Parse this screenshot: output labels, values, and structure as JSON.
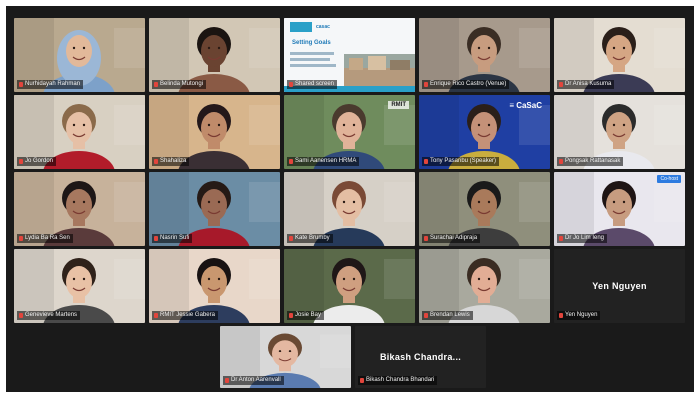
{
  "participants": [
    {
      "id": "p1",
      "name": "Nurhidayah Rahman",
      "bg": "#b9a98f",
      "skin": "#e2b99a",
      "top": "#7da1c9",
      "hair": "#9bb7d6",
      "hijab": true
    },
    {
      "id": "p2",
      "name": "Belinda Mutongi",
      "bg": "#d2c7b5",
      "skin": "#6a4331",
      "top": "#8a5a45",
      "hair": "#1b1411"
    },
    {
      "id": "p3",
      "name": "Shared screen",
      "slide": true
    },
    {
      "id": "p4",
      "name": "Enrique Rico Castro (Venue)",
      "bg": "#a79a8c",
      "skin": "#c79c7f",
      "top": "#2b3544",
      "hair": "#3a2d24"
    },
    {
      "id": "p5",
      "name": "Dr Anisa Kusuma",
      "bg": "#e4ddd2",
      "skin": "#d5a684",
      "top": "#3b3b55",
      "hair": "#2a1f1a"
    },
    {
      "id": "p6",
      "name": "Jo Gordon",
      "bg": "#d8d0c2",
      "skin": "#e6c0a6",
      "top": "#b21c2a",
      "hair": "#8a6a4a",
      "active": true
    },
    {
      "id": "p7",
      "name": "Shahaliza",
      "bg": "#d7b58c",
      "skin": "#c08b6a",
      "top": "#3a2f34",
      "hair": "#24181a"
    },
    {
      "id": "p8",
      "name": "Sami Aanensen HRMA",
      "bg": "#6f8c5d",
      "skin": "#e0b399",
      "top": "#304a7a",
      "hair": "#4a3a2e",
      "logo": "RMIT"
    },
    {
      "id": "p9",
      "name": "Tony Pasaribu (Speaker)",
      "bg": "#1f3fa3",
      "skin": "#c49178",
      "top": "#c9ad3e",
      "hair": "#2a1f1a",
      "banner": "≡ CaSaC"
    },
    {
      "id": "p10",
      "name": "Pongsak Rattanasak",
      "bg": "#e5e1dc",
      "skin": "#cfa384",
      "top": "#e9e9ee",
      "hair": "#2b2b2b"
    },
    {
      "id": "p11",
      "name": "Lydia Ba Ra Sen",
      "bg": "#c7b29b",
      "skin": "#a7785f",
      "top": "#5a3b3b",
      "hair": "#1d1616"
    },
    {
      "id": "p12",
      "name": "Nasrin Sufi",
      "bg": "#6b8da5",
      "skin": "#9a6a54",
      "top": "#a7192a",
      "hair": "#251a16"
    },
    {
      "id": "p13",
      "name": "Kate Brumby",
      "bg": "#d6d0c7",
      "skin": "#e4bea3",
      "top": "#263a5a",
      "hair": "#7a4a36"
    },
    {
      "id": "p14",
      "name": "Surachai Adipraja",
      "bg": "#8f8f7c",
      "skin": "#a97a5b",
      "top": "#3d3d3d",
      "hair": "#1a1a1a"
    },
    {
      "id": "p15",
      "name": "Dr Jo Lim Ieng",
      "bg": "#e9e7ee",
      "skin": "#c79c80",
      "top": "#5b4a6a",
      "hair": "#1f1515",
      "badge": "Co-host"
    },
    {
      "id": "p16",
      "name": "Genevieve Martens",
      "bg": "#ddd6cc",
      "skin": "#e8c1a5",
      "top": "#4a4a4a",
      "hair": "#2f221a"
    },
    {
      "id": "p17",
      "name": "RMIT Jessie Gabera",
      "bg": "#e8d7c9",
      "skin": "#c9976f",
      "top": "#2d3d5e",
      "hair": "#181212"
    },
    {
      "id": "p18",
      "name": "Josie Bay",
      "bg": "#5b6a4a",
      "skin": "#cf9f80",
      "top": "#ececec",
      "hair": "#1f1717"
    },
    {
      "id": "p19",
      "name": "Brendan Lewis",
      "bg": "#a9a99e",
      "skin": "#e2ad95",
      "top": "#d7d7d7",
      "hair": "#3a2c22"
    },
    {
      "id": "p20",
      "name": "Yen Nguyen",
      "noVideo": true
    },
    {
      "id": "p21",
      "name": "Dr Anton Aarenvall",
      "bg": "#d8d8d8",
      "skin": "#e4b8a1",
      "top": "#5a7bb0",
      "hair": "#6a4a34"
    },
    {
      "id": "p22",
      "name": "Bikash Chandra...",
      "noVideo": true,
      "plateName": "Bikash Chandra Bhandari"
    }
  ],
  "slide": {
    "title": "Setting Goals",
    "logo_text": "casac"
  },
  "no_video_labels": {
    "p20": "Yen Nguyen",
    "p22": "Bikash Chandra..."
  }
}
